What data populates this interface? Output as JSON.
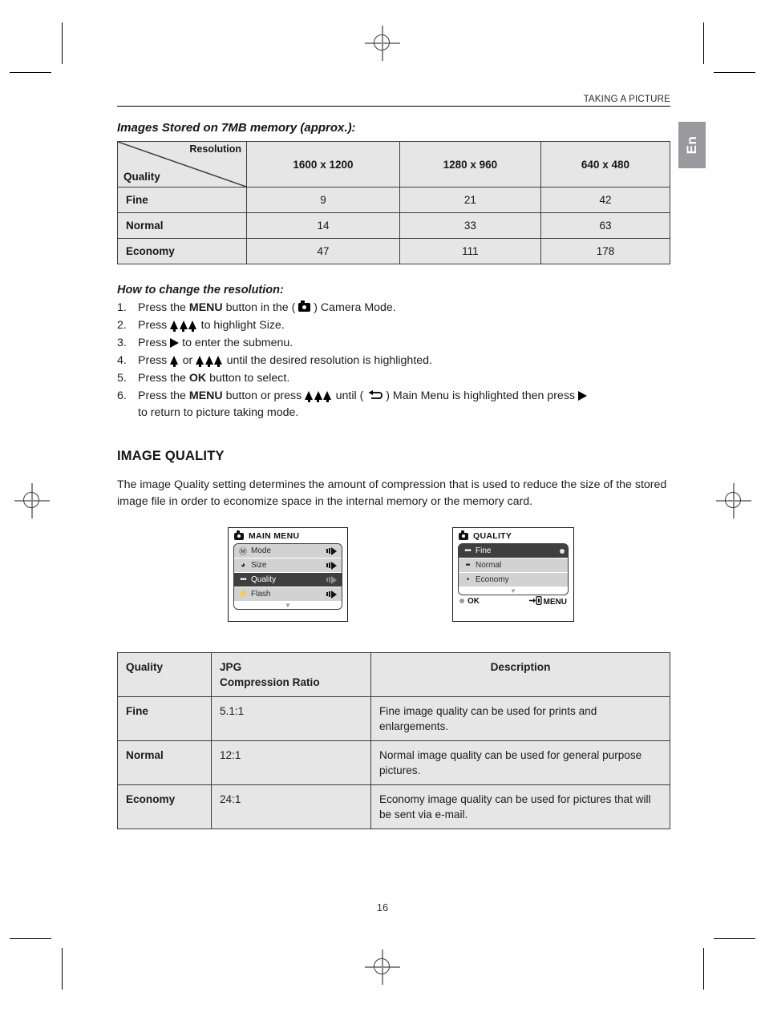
{
  "header": {
    "running_head": "TAKING A PICTURE",
    "side_tab": "En"
  },
  "storage_section": {
    "title": "Images Stored on 7MB memory (approx.):",
    "table": {
      "corner_top_label": "Resolution",
      "corner_bottom_label": "Quality",
      "columns": [
        "1600 x 1200",
        "1280 x 960",
        "640 x 480"
      ],
      "rows": [
        {
          "label": "Fine",
          "values": [
            "9",
            "21",
            "42"
          ]
        },
        {
          "label": "Normal",
          "values": [
            "14",
            "33",
            "63"
          ]
        },
        {
          "label": "Economy",
          "values": [
            "47",
            "111",
            "178"
          ]
        }
      ]
    }
  },
  "howto": {
    "title": "How to change the resolution:",
    "steps": [
      {
        "num": "1.",
        "parts": [
          {
            "t": "text",
            "v": "Press the "
          },
          {
            "t": "bold",
            "v": "MENU"
          },
          {
            "t": "text",
            "v": " button in the ( "
          },
          {
            "t": "icon",
            "v": "camera-icon"
          },
          {
            "t": "text",
            "v": " ) Camera Mode."
          }
        ]
      },
      {
        "num": "2.",
        "parts": [
          {
            "t": "text",
            "v": "Press "
          },
          {
            "t": "icon",
            "v": "triple-up-arrow-icon"
          },
          {
            "t": "text",
            "v": " to highlight Size."
          }
        ]
      },
      {
        "num": "3.",
        "parts": [
          {
            "t": "text",
            "v": "Press "
          },
          {
            "t": "icon",
            "v": "right-arrow-icon"
          },
          {
            "t": "text",
            "v": " to enter the submenu."
          }
        ]
      },
      {
        "num": "4.",
        "parts": [
          {
            "t": "text",
            "v": "Press "
          },
          {
            "t": "icon",
            "v": "single-up-arrow-icon"
          },
          {
            "t": "text",
            "v": " or "
          },
          {
            "t": "icon",
            "v": "triple-up-arrow-icon"
          },
          {
            "t": "text",
            "v": " until the desired resolution is highlighted."
          }
        ]
      },
      {
        "num": "5.",
        "parts": [
          {
            "t": "text",
            "v": "Press the "
          },
          {
            "t": "bold",
            "v": "OK"
          },
          {
            "t": "text",
            "v": " button to select."
          }
        ]
      },
      {
        "num": "6.",
        "parts": [
          {
            "t": "text",
            "v": "Press the "
          },
          {
            "t": "bold",
            "v": "MENU"
          },
          {
            "t": "text",
            "v": " button or press "
          },
          {
            "t": "icon",
            "v": "triple-up-arrow-icon"
          },
          {
            "t": "text",
            "v": " until ( "
          },
          {
            "t": "icon",
            "v": "return-arrow-icon"
          },
          {
            "t": "text",
            "v": " ) Main Menu is highlighted then press "
          },
          {
            "t": "icon",
            "v": "right-arrow-icon"
          },
          {
            "t": "text",
            "v": ""
          }
        ],
        "continuation": "to return to picture taking mode."
      }
    ]
  },
  "image_quality": {
    "heading": "IMAGE QUALITY",
    "paragraph": "The image Quality setting determines the amount of compression that is used to reduce the size of the stored image file in order to economize space in the internal memory or the memory card."
  },
  "lcd_main_menu": {
    "title": "MAIN MENU",
    "title_icon": "camera-icon",
    "items": [
      {
        "icon": "mode-dial-icon",
        "icon_glyph": "Ⓜ",
        "label": "Mode",
        "selected": false
      },
      {
        "icon": "size-circle-icon",
        "icon_glyph": "◕",
        "label": "Size",
        "selected": false
      },
      {
        "icon": "quality-dots-icon",
        "icon_glyph": "•••",
        "label": "Quality",
        "selected": true
      },
      {
        "icon": "flash-icon",
        "icon_glyph": "⚡",
        "label": "Flash",
        "selected": false
      }
    ],
    "scroll_indicator": "▼"
  },
  "lcd_quality_menu": {
    "title": "QUALITY",
    "title_icon": "camera-icon",
    "items": [
      {
        "icon": "three-dots-icon",
        "icon_glyph": "•••",
        "label": "Fine",
        "selected": true,
        "mark": true
      },
      {
        "icon": "two-dots-icon",
        "icon_glyph": "••",
        "label": "Normal",
        "selected": false,
        "mark": false
      },
      {
        "icon": "one-dot-icon",
        "icon_glyph": "•",
        "label": "Economy",
        "selected": false,
        "mark": false
      }
    ],
    "scroll_indicator": "▼",
    "footer_ok": "OK",
    "footer_menu": "MENU"
  },
  "quality_table": {
    "headers": [
      "Quality",
      "JPG\nCompression Ratio",
      "Description"
    ],
    "header_col1": "Quality",
    "header_col2_line1": "JPG",
    "header_col2_line2": "Compression Ratio",
    "header_col3": "Description",
    "rows": [
      {
        "quality": "Fine",
        "ratio": "5.1:1",
        "description": "Fine image quality can be used for prints and enlargements."
      },
      {
        "quality": "Normal",
        "ratio": "12:1",
        "description": "Normal image quality can be used for general purpose pictures."
      },
      {
        "quality": "Economy",
        "ratio": "24:1",
        "description": "Economy image quality can be used for pictures that will be sent via e-mail."
      }
    ]
  },
  "footer": {
    "page_number": "16"
  },
  "colors": {
    "table_fill": "#e6e6e6",
    "tab_gray": "#9a9a9e",
    "selected_row": "#3f3f3f",
    "lcd_row": "#d2d2d2"
  }
}
